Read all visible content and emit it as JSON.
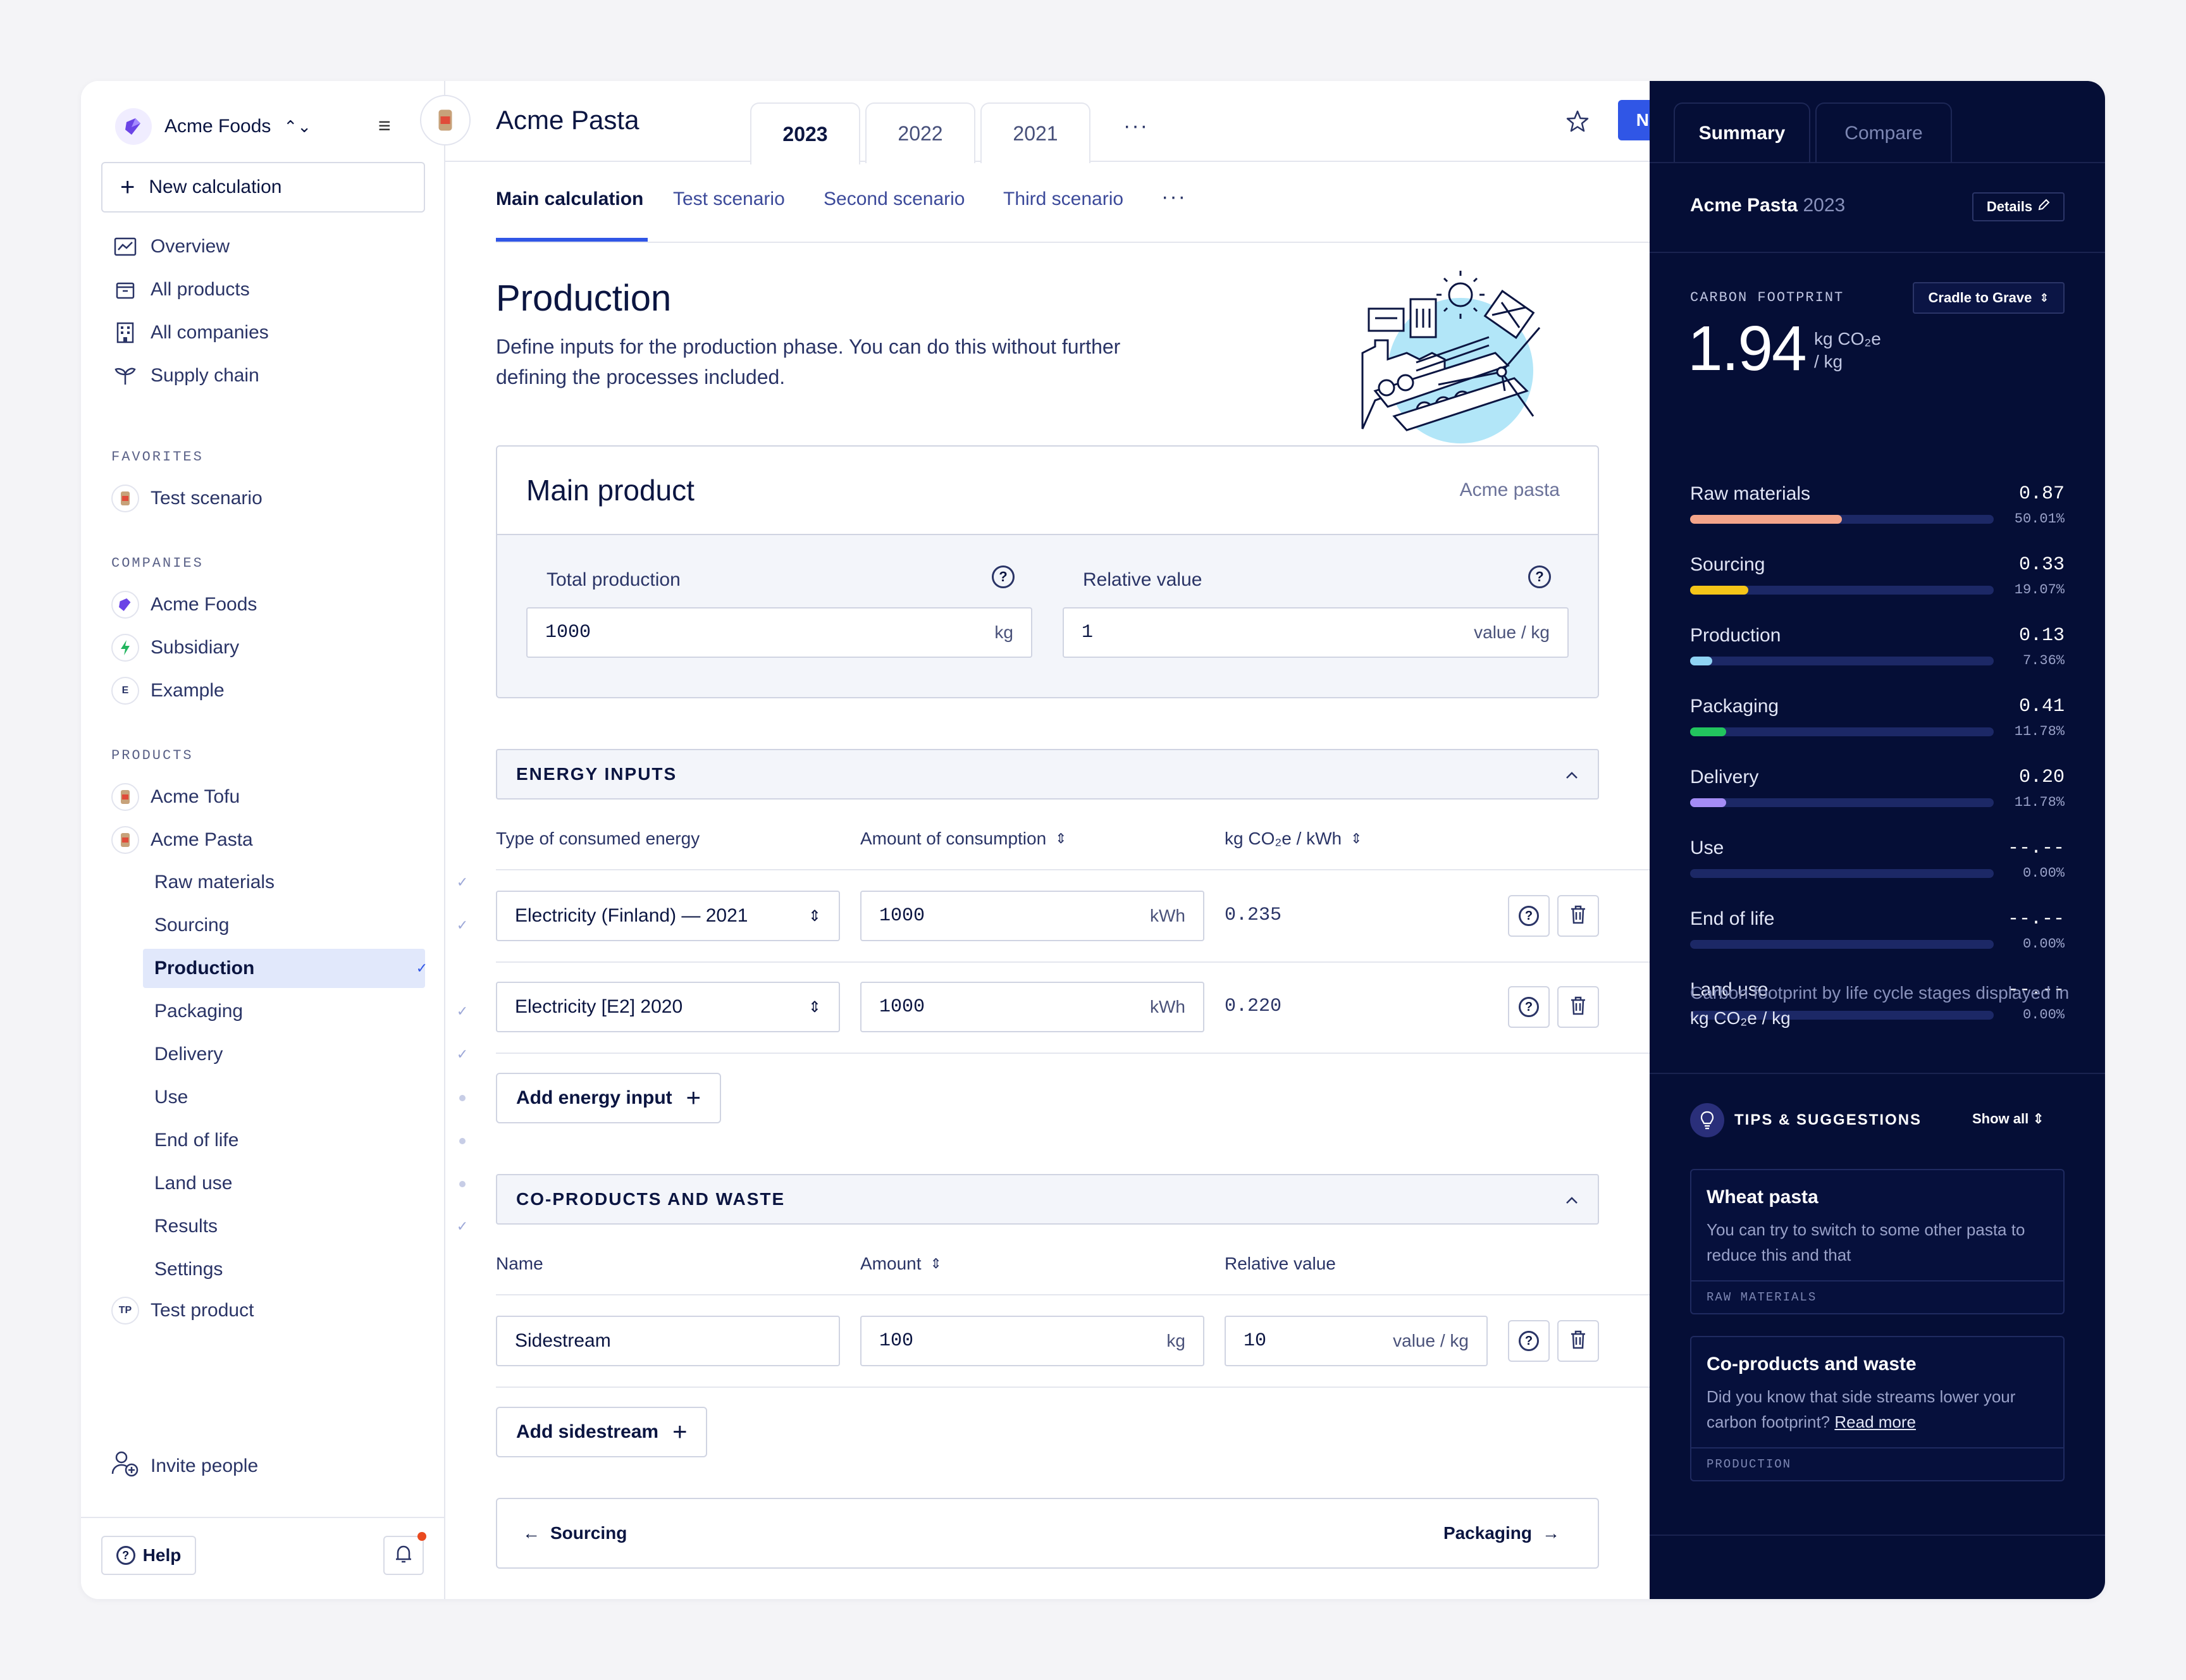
{
  "sidebar": {
    "org_name": "Acme Foods",
    "new_calc_label": "New calculation",
    "nav": [
      {
        "label": "Overview",
        "icon": "chart-icon"
      },
      {
        "label": "All products",
        "icon": "box-icon"
      },
      {
        "label": "All companies",
        "icon": "building-icon"
      },
      {
        "label": "Supply chain",
        "icon": "sprout-icon"
      }
    ],
    "favorites_title": "FAVORITES",
    "favorites": [
      {
        "label": "Test scenario"
      }
    ],
    "companies_title": "COMPANIES",
    "companies": [
      {
        "label": "Acme Foods",
        "badge": ""
      },
      {
        "label": "Subsidiary",
        "badge": ""
      },
      {
        "label": "Example",
        "badge": "E"
      }
    ],
    "products_title": "PRODUCTS",
    "products": [
      {
        "label": "Acme Tofu"
      },
      {
        "label": "Acme Pasta"
      }
    ],
    "product_steps": [
      {
        "label": "Raw materials",
        "state": "done"
      },
      {
        "label": "Sourcing",
        "state": "done"
      },
      {
        "label": "Production",
        "state": "active"
      },
      {
        "label": "Packaging",
        "state": "done"
      },
      {
        "label": "Delivery",
        "state": "done"
      },
      {
        "label": "Use",
        "state": "pending"
      },
      {
        "label": "End of life",
        "state": "pending"
      },
      {
        "label": "Land use",
        "state": "pending"
      },
      {
        "label": "Results",
        "state": "done"
      },
      {
        "label": "Settings",
        "state": "none"
      }
    ],
    "test_product": {
      "label": "Test product",
      "badge": "TP"
    },
    "invite_label": "Invite people",
    "help_label": "Help"
  },
  "header": {
    "product_title": "Acme Pasta",
    "year_tabs": [
      "2023",
      "2022",
      "2021"
    ],
    "more": "···",
    "new_label": "New"
  },
  "scenario_tabs": [
    "Main calculation",
    "Test scenario",
    "Second scenario",
    "Third scenario"
  ],
  "page": {
    "title": "Production",
    "description": "Define inputs for the production phase. You can do this without further defining the processes included."
  },
  "main_product": {
    "title": "Main product",
    "name": "Acme pasta",
    "total_production_label": "Total production",
    "total_production_value": "1000",
    "total_production_unit": "kg",
    "relative_value_label": "Relative value",
    "relative_value_value": "1",
    "relative_value_unit": "value / kg"
  },
  "energy": {
    "title": "ENERGY INPUTS",
    "col_type": "Type of consumed energy",
    "col_amount": "Amount of consumption",
    "col_factor": "kg CO₂e / kWh",
    "rows": [
      {
        "type": "Electricity (Finland) — 2021",
        "amount": "1000",
        "unit": "kWh",
        "factor": "0.235"
      },
      {
        "type": "Electricity [E2] 2020",
        "amount": "1000",
        "unit": "kWh",
        "factor": "0.220"
      }
    ],
    "add_label": "Add energy input"
  },
  "coproducts": {
    "title": "CO-PRODUCTS AND WASTE",
    "col_name": "Name",
    "col_amount": "Amount",
    "col_relative": "Relative value",
    "rows": [
      {
        "name": "Sidestream",
        "amount": "100",
        "unit": "kg",
        "relative": "10",
        "relative_unit": "value / kg"
      }
    ],
    "add_label": "Add sidestream"
  },
  "footer_nav": {
    "prev": "Sourcing",
    "next": "Packaging"
  },
  "summary": {
    "tabs": [
      "Summary",
      "Compare"
    ],
    "title_product": "Acme Pasta",
    "title_year": "2023",
    "details_label": "Details",
    "cf_label": "CARBON FOOTPRINT",
    "scope_label": "Cradle to Grave",
    "total": "1.94",
    "unit_line1": "kg CO₂e",
    "unit_line2": "/ kg",
    "stages": [
      {
        "name": "Raw materials",
        "value": "0.87",
        "percent": "50.01%",
        "fraction": 0.5001,
        "color": "#f4a48a"
      },
      {
        "name": "Sourcing",
        "value": "0.33",
        "percent": "19.07%",
        "fraction": 0.1907,
        "color": "#f5c518"
      },
      {
        "name": "Production",
        "value": "0.13",
        "percent": "7.36%",
        "fraction": 0.0736,
        "color": "#8fd3f4"
      },
      {
        "name": "Packaging",
        "value": "0.41",
        "percent": "11.78%",
        "fraction": 0.1178,
        "color": "#22c55e"
      },
      {
        "name": "Delivery",
        "value": "0.20",
        "percent": "11.78%",
        "fraction": 0.1178,
        "color": "#a48cf5"
      },
      {
        "name": "Use",
        "value": "--.--",
        "percent": "0.00%",
        "fraction": 0,
        "color": "#a48cf5"
      },
      {
        "name": "End of life",
        "value": "--.--",
        "percent": "0.00%",
        "fraction": 0,
        "color": "#a48cf5"
      },
      {
        "name": "Land use",
        "value": "--.--",
        "percent": "0.00%",
        "fraction": 0,
        "color": "#a48cf5"
      }
    ],
    "note_text": "Carbon footprint by life cycle stages displayed in",
    "note_unit": "kg CO₂e / kg",
    "tips_title": "TIPS & SUGGESTIONS",
    "show_all": "Show all",
    "tips": [
      {
        "title": "Wheat pasta",
        "body": "You can try to switch to some other pasta to reduce this and that",
        "link": "",
        "tag": "RAW MATERIALS"
      },
      {
        "title": "Co-products and waste",
        "body": "Did you know that side streams lower your carbon footprint?",
        "link": "Read more",
        "tag": "PRODUCTION"
      }
    ]
  }
}
